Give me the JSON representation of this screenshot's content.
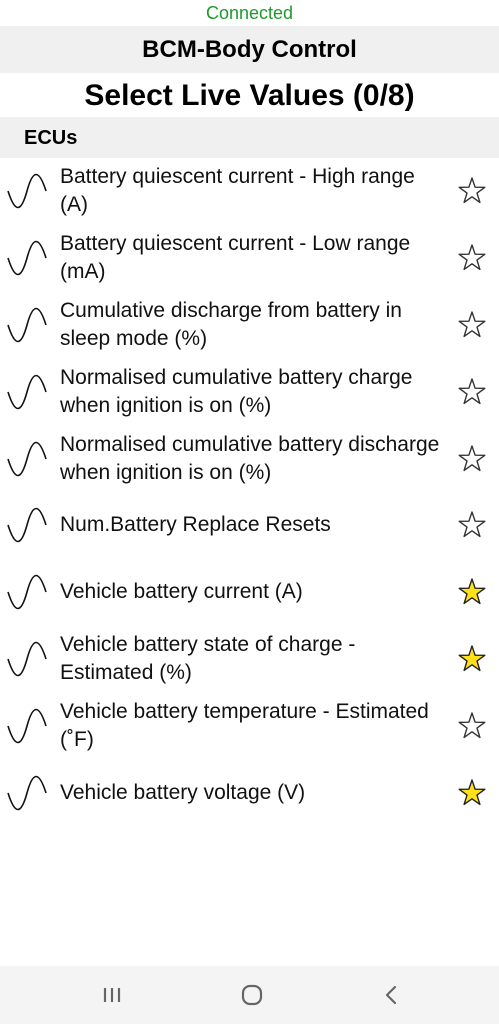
{
  "status": {
    "text": "Connected"
  },
  "header": {
    "title": "BCM-Body Control"
  },
  "page": {
    "title": "Select Live Values (0/8)"
  },
  "section": {
    "label": "ECUs"
  },
  "colors": {
    "connected": "#1e9a2e",
    "star_filled": "#ffe11a",
    "star_outline": "#333333"
  },
  "items": [
    {
      "label": "Battery quiescent current  -  High range (A)",
      "starred": false
    },
    {
      "label": "Battery quiescent current  -  Low range (mA)",
      "starred": false
    },
    {
      "label": "Cumulative discharge from battery in sleep mode (%)",
      "starred": false
    },
    {
      "label": "Normalised cumulative battery charge when ignition is on (%)",
      "starred": false
    },
    {
      "label": "Normalised cumulative battery discharge when ignition is on (%)",
      "starred": false
    },
    {
      "label": "Num.Battery Replace Resets",
      "starred": false
    },
    {
      "label": "Vehicle battery current (A)",
      "starred": true
    },
    {
      "label": "Vehicle battery state of charge  -  Estimated (%)",
      "starred": true
    },
    {
      "label": "Vehicle battery temperature  -  Estimated (˚F)",
      "starred": false
    },
    {
      "label": "Vehicle battery voltage (V)",
      "starred": true
    }
  ],
  "icons": {
    "row_icon": "sine-wave-icon",
    "favorite": "star-icon",
    "recents": "recents-icon",
    "home": "home-icon",
    "back": "back-icon"
  }
}
